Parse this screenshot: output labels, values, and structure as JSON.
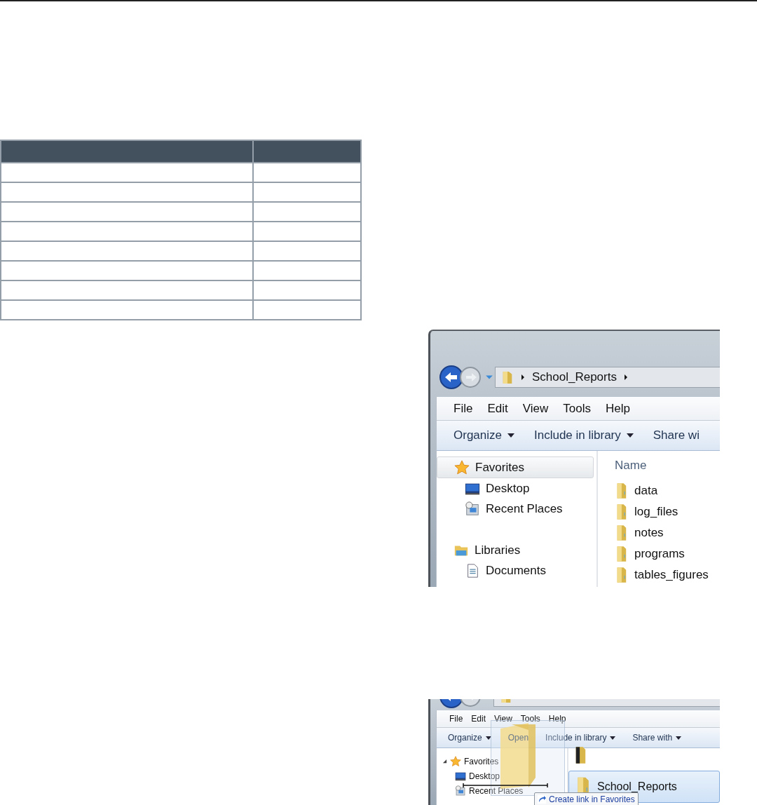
{
  "page_table": {
    "rows": [
      {
        "cells": [
          {
            "kind": "header"
          },
          {
            "kind": "header"
          }
        ]
      },
      {
        "cells": [
          {
            "kind": "body"
          },
          {
            "kind": "body"
          }
        ]
      },
      {
        "cells": [
          {
            "kind": "body"
          },
          {
            "kind": "body"
          }
        ]
      },
      {
        "cells": [
          {
            "kind": "body"
          },
          {
            "kind": "body"
          }
        ]
      },
      {
        "cells": [
          {
            "kind": "body"
          },
          {
            "kind": "body"
          }
        ]
      },
      {
        "cells": [
          {
            "kind": "body"
          },
          {
            "kind": "body"
          }
        ]
      },
      {
        "cells": [
          {
            "kind": "body"
          },
          {
            "kind": "body"
          }
        ]
      },
      {
        "cells": [
          {
            "kind": "body"
          },
          {
            "kind": "body"
          }
        ]
      },
      {
        "cells": [
          {
            "kind": "body"
          },
          {
            "kind": "body"
          }
        ]
      }
    ]
  },
  "explorers": [
    {
      "kind": "large",
      "address": [
        "School_Reports"
      ],
      "menu": [
        "File",
        "Edit",
        "View",
        "Tools",
        "Help"
      ],
      "toolbar": [
        {
          "label": "Organize",
          "dropdown": true,
          "disabled": false
        },
        {
          "label": "Include in library",
          "dropdown": true,
          "disabled": false
        },
        {
          "label": "Share wi",
          "dropdown": false,
          "disabled": false
        }
      ],
      "nav": [
        {
          "label": "Favorites",
          "selected": true,
          "children": [
            {
              "label": "Desktop",
              "selected": false
            },
            {
              "label": "Recent Places",
              "selected": false
            }
          ]
        },
        {
          "label": "Libraries",
          "selected": false,
          "children": [
            {
              "label": "Documents",
              "selected": false
            }
          ]
        }
      ],
      "column_header": "Name",
      "files": [
        {
          "name": "data",
          "selected": false
        },
        {
          "name": "log_files",
          "selected": false
        },
        {
          "name": "notes",
          "selected": false
        },
        {
          "name": "programs",
          "selected": false
        },
        {
          "name": "tables_figures",
          "selected": false
        }
      ]
    },
    {
      "kind": "small",
      "menu": [
        "File",
        "Edit",
        "View",
        "Tools",
        "Help"
      ],
      "toolbar": [
        {
          "label": "Organize",
          "dropdown": true,
          "disabled": false
        },
        {
          "label": "Open",
          "dropdown": false,
          "disabled": true
        },
        {
          "label": "Include in library",
          "dropdown": true,
          "disabled": false
        },
        {
          "label": "Share with",
          "dropdown": true,
          "disabled": false
        }
      ],
      "nav": [
        {
          "label": "Favorites",
          "selected": false,
          "expanded": true,
          "children": [
            {
              "label": "Desktop",
              "selected": false
            },
            {
              "label": "Recent Places",
              "selected": false
            }
          ]
        }
      ],
      "files": [
        {
          "name": "School_Reports",
          "selected": true
        }
      ],
      "drag": {
        "tooltip": "Create link in Favorites"
      }
    }
  ]
}
